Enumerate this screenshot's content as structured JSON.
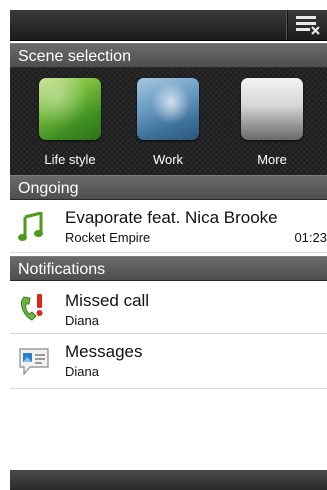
{
  "scene_section": {
    "header": "Scene selection",
    "scenes": [
      {
        "label": "Life style",
        "icon": "lifestyle-scene-thumbnail"
      },
      {
        "label": "Work",
        "icon": "work-scene-thumbnail"
      },
      {
        "label": "More",
        "icon": "more-scene-thumbnail"
      }
    ]
  },
  "ongoing_section": {
    "header": "Ongoing",
    "item": {
      "title": "Evaporate feat. Nica Brooke",
      "subtitle": "Rocket Empire",
      "time": "01:23",
      "icon": "music-note-icon"
    }
  },
  "notifications_section": {
    "header": "Notifications",
    "items": [
      {
        "title": "Missed call",
        "subtitle": "Diana",
        "icon": "missed-call-icon"
      },
      {
        "title": "Messages",
        "subtitle": "Diana",
        "icon": "message-icon"
      }
    ]
  },
  "colors": {
    "header_bg": "#5b5b5b",
    "accent_green": "#4e9a1a",
    "missed_red": "#d9251c"
  }
}
